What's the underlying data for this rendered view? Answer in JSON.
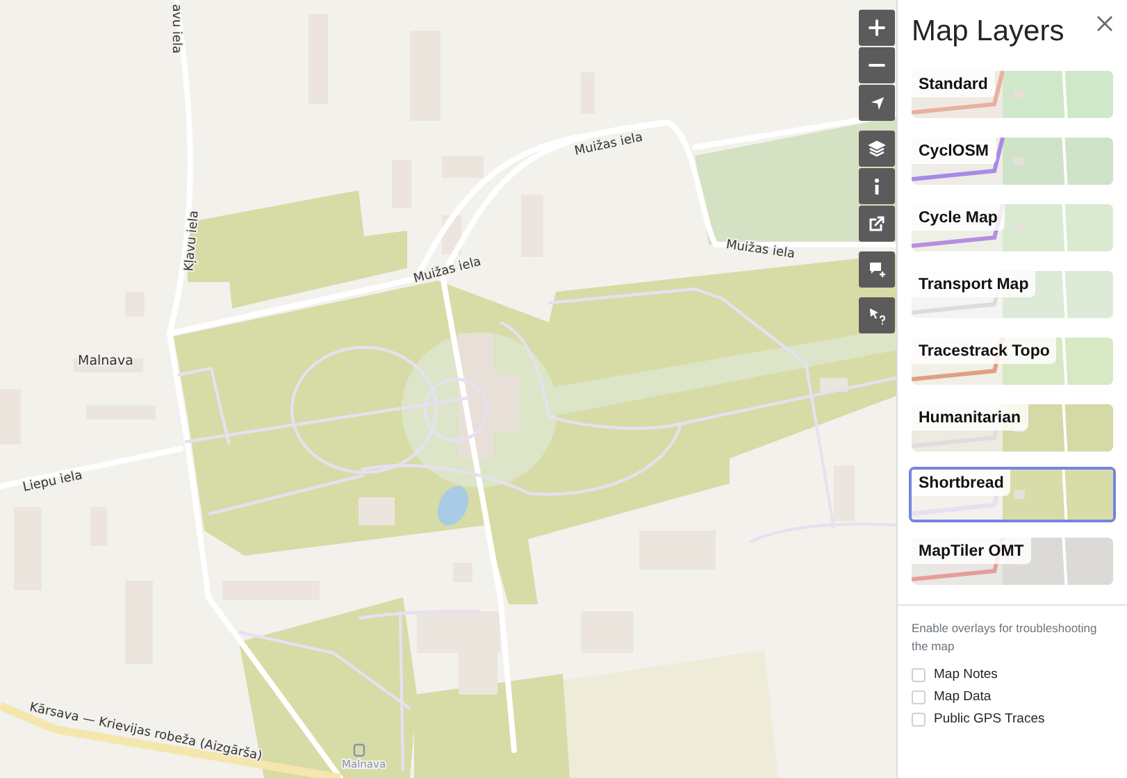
{
  "map": {
    "labels": [
      {
        "text": "avu iela",
        "kind": "street"
      },
      {
        "text": "Kļavu iela",
        "kind": "street"
      },
      {
        "text": "Muižas iela",
        "kind": "street"
      },
      {
        "text": "Muižas iela",
        "kind": "street"
      },
      {
        "text": "Muižas iela",
        "kind": "street"
      },
      {
        "text": "Malnava",
        "kind": "place"
      },
      {
        "text": "Liepu iela",
        "kind": "street"
      },
      {
        "text": "Kārsava — Krievijas robeža (Aizgārša)",
        "kind": "street"
      },
      {
        "text": "Malnava",
        "kind": "stop"
      }
    ]
  },
  "panel": {
    "title": "Map Layers",
    "layers": [
      {
        "name": "Standard",
        "selected": false
      },
      {
        "name": "CyclOSM",
        "selected": false
      },
      {
        "name": "Cycle Map",
        "selected": false
      },
      {
        "name": "Transport Map",
        "selected": false
      },
      {
        "name": "Tracestrack Topo",
        "selected": false
      },
      {
        "name": "Humanitarian",
        "selected": false
      },
      {
        "name": "Shortbread",
        "selected": true
      },
      {
        "name": "MapTiler OMT",
        "selected": false
      }
    ],
    "overlay_hint": "Enable overlays for troubleshooting the map",
    "overlays": [
      {
        "label": "Map Notes",
        "checked": false
      },
      {
        "label": "Map Data",
        "checked": false
      },
      {
        "label": "Public GPS Traces",
        "checked": false
      }
    ]
  }
}
